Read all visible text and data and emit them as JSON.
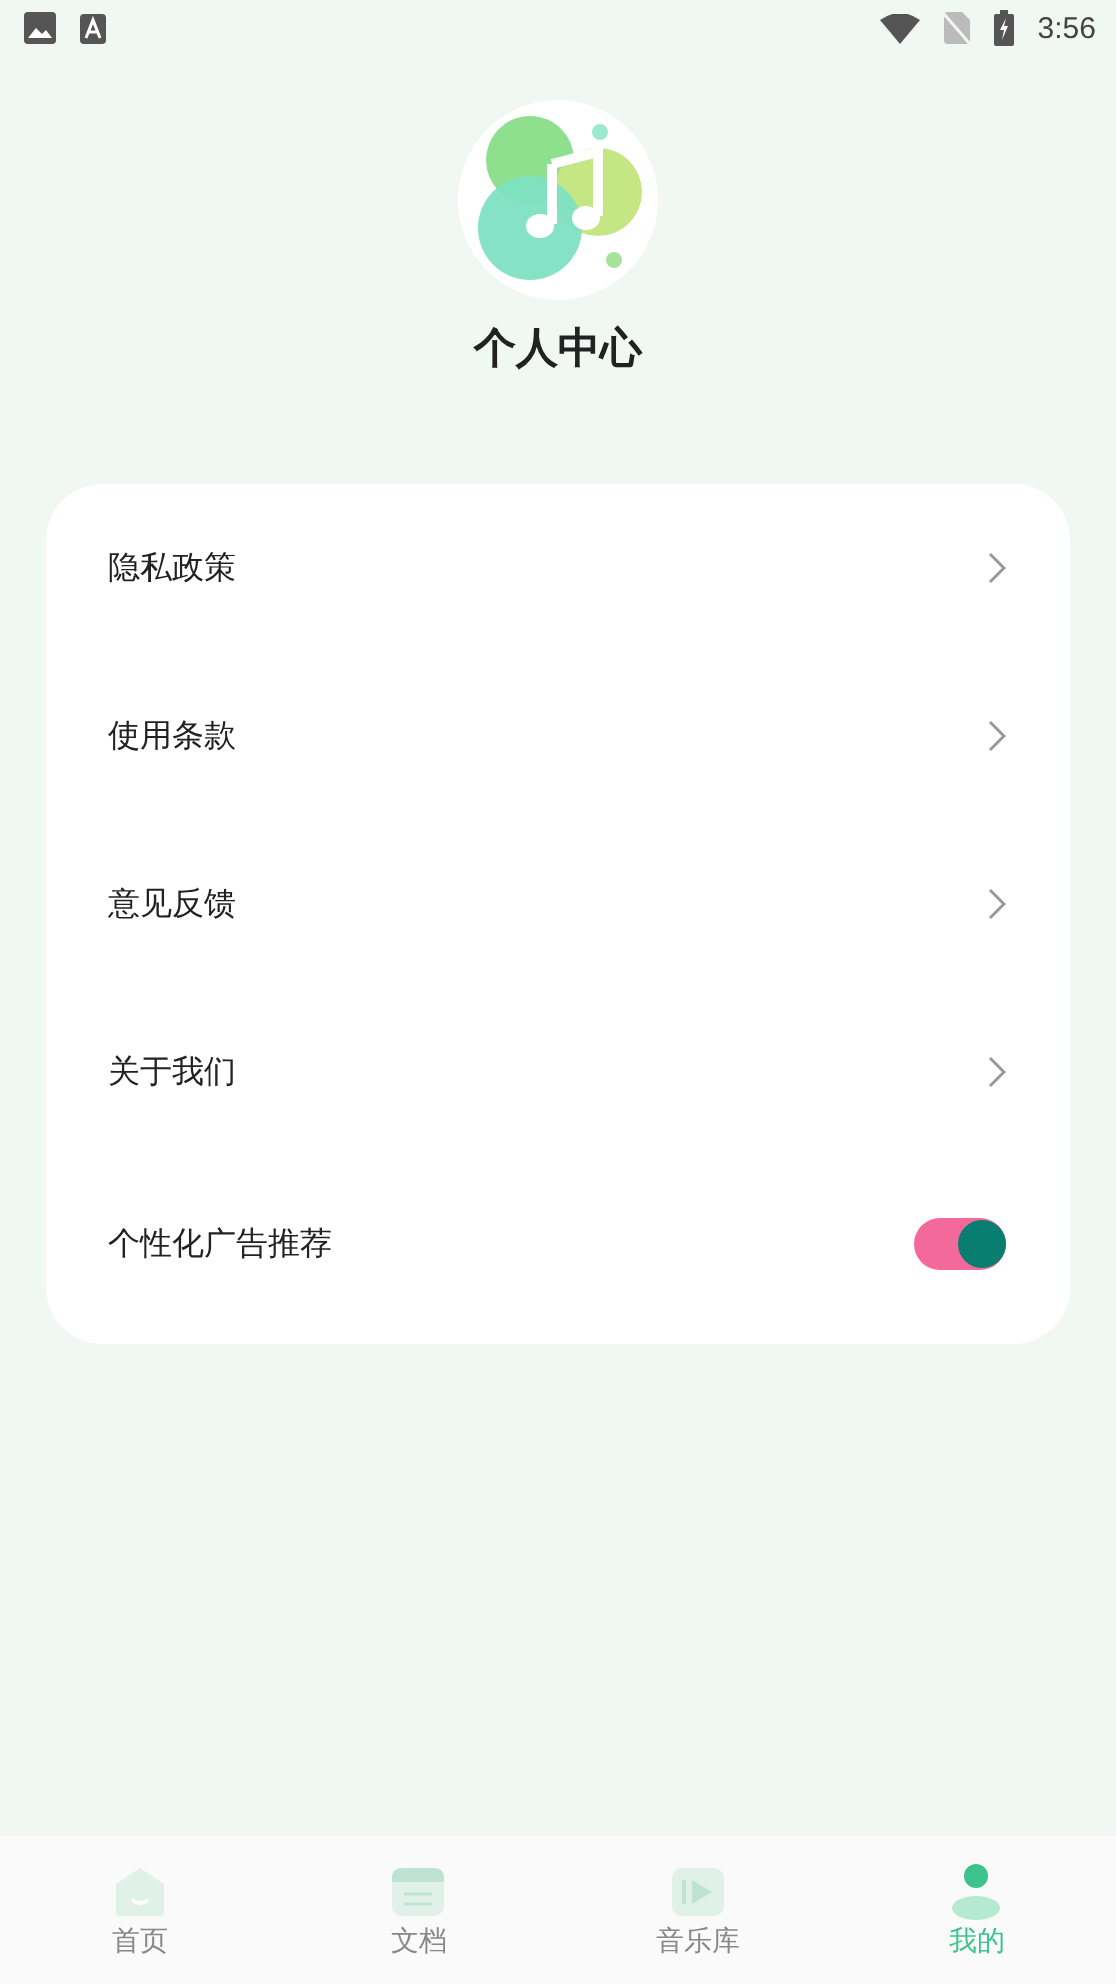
{
  "status_bar": {
    "time": "3:56"
  },
  "profile": {
    "title": "个人中心"
  },
  "menu": [
    {
      "kind": "link",
      "label": "隐私政策"
    },
    {
      "kind": "link",
      "label": "使用条款"
    },
    {
      "kind": "link",
      "label": "意见反馈"
    },
    {
      "kind": "link",
      "label": "关于我们"
    },
    {
      "kind": "toggle",
      "label": "个性化广告推荐",
      "on": true
    }
  ],
  "tabs": [
    {
      "kind": "home",
      "label": "首页",
      "selected": false
    },
    {
      "kind": "docs",
      "label": "文档",
      "selected": false
    },
    {
      "kind": "music",
      "label": "音乐库",
      "selected": false
    },
    {
      "kind": "me",
      "label": "我的",
      "selected": true
    }
  ]
}
